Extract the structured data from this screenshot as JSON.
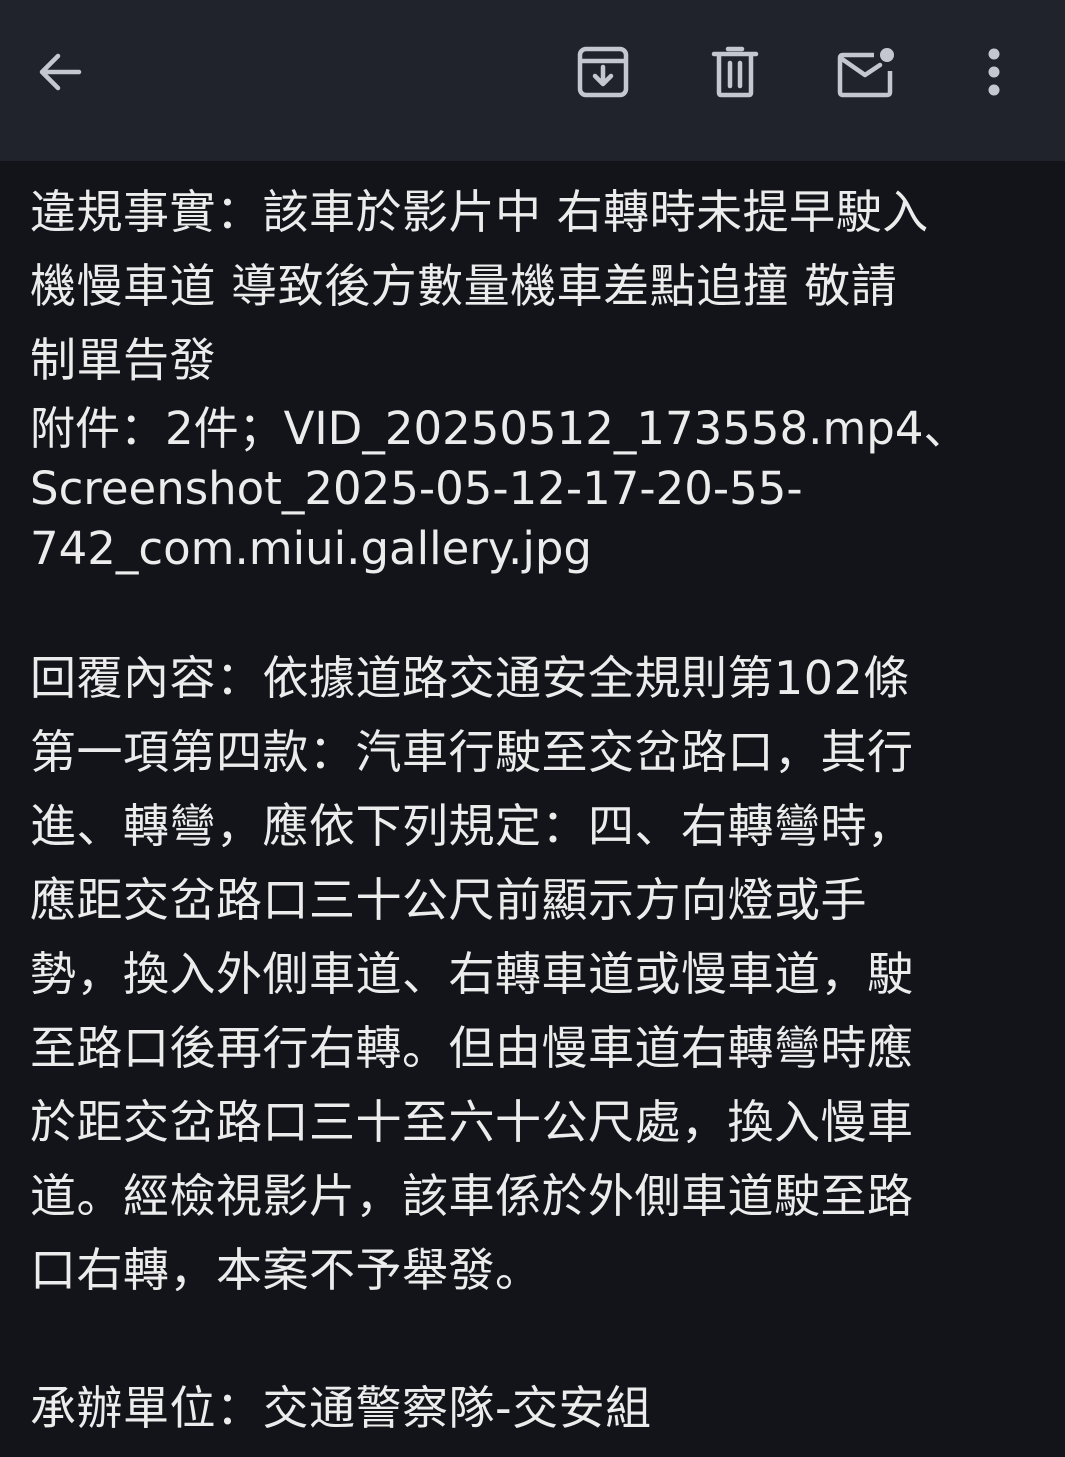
{
  "toolbar": {
    "icons": {
      "back": "arrow-left-icon",
      "archive": "archive-icon",
      "delete": "trash-icon",
      "unread": "mark-unread-icon",
      "more": "more-vertical-icon"
    },
    "colors": {
      "background": "#20232b",
      "icon": "#c4c7cf"
    }
  },
  "colors": {
    "page_background": "#13141a",
    "text": "#ececec"
  },
  "email": {
    "violation_lines": [
      "違規事實：該車於影片中 右轉時未提早駛入",
      "機慢車道 導致後方數量機車差點追撞 敬請",
      "制單告發"
    ],
    "attachment_lines": [
      "附件：2件；VID_20250512_173558.mp4、",
      "Screenshot_2025-05-12-17-20-55-",
      "742_com.miui.gallery.jpg"
    ],
    "reply_lines": [
      "回覆內容：依據道路交通安全規則第102條",
      "第一項第四款：汽車行駛至交岔路口，其行",
      "進、轉彎，應依下列規定：四、右轉彎時，",
      "應距交岔路口三十公尺前顯示方向燈或手",
      "勢，換入外側車道、右轉車道或慢車道，駛",
      "至路口後再行右轉。但由慢車道右轉彎時應",
      "於距交岔路口三十至六十公尺處，換入慢車",
      "道。經檢視影片，該車係於外側車道駛至路",
      "口右轉，本案不予舉發。"
    ],
    "unit_line": "承辦單位：交通警察隊-交安組"
  }
}
